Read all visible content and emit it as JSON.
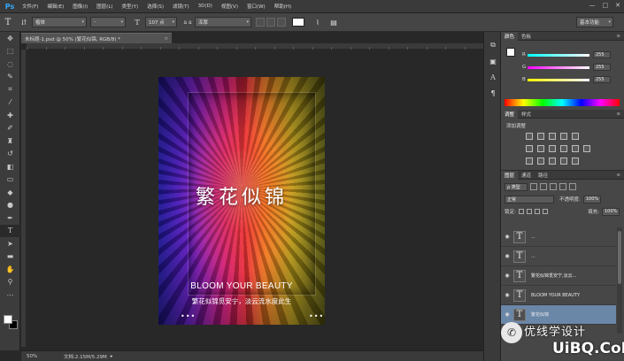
{
  "app": {
    "logo": "Ps"
  },
  "menu": [
    "文件(F)",
    "编辑(E)",
    "图像(I)",
    "图层(L)",
    "类型(Y)",
    "选择(S)",
    "滤镜(T)",
    "3D(D)",
    "视图(V)",
    "窗口(W)",
    "帮助(H)"
  ],
  "window_controls": [
    "—",
    "□",
    "✕"
  ],
  "options": {
    "font_family": "楷体",
    "font_style": "-",
    "font_size": "107 点",
    "aa_label": "a a",
    "aa_value": "浑厚",
    "text_color": "#ffffff",
    "workspace": "基本功能"
  },
  "document": {
    "tab_title": "未标题-1.psd @ 50% (繁花似锦, RGB/8) *",
    "tab_close": "×",
    "zoom": "50%",
    "doc_size": "文档:2.15M/5.29M"
  },
  "artwork": {
    "title": "繁花似锦",
    "subtitle": "BLOOM YOUR BEAUTY",
    "tagline": "繁花似锦觅安宁，淡云流水度此生",
    "dots_left": "•••",
    "dots_right": "•••"
  },
  "color_panel": {
    "tabs": [
      "颜色",
      "色板"
    ],
    "r_label": "R",
    "r_value": "255",
    "g_label": "G",
    "g_value": "255",
    "b_label": "B",
    "b_value": "255"
  },
  "adjust_panel": {
    "tabs": [
      "调整",
      "样式"
    ],
    "label": "添加调整"
  },
  "layers_panel": {
    "tabs": [
      "图层",
      "通道",
      "路径"
    ],
    "filter": "ρ 类型",
    "blend_mode": "正常",
    "opacity_label": "不透明度:",
    "opacity_value": "100%",
    "lock_label": "锁定:",
    "fill_label": "填充:",
    "fill_value": "100%",
    "layers": [
      {
        "name": "...",
        "selected": false
      },
      {
        "name": "...",
        "selected": false
      },
      {
        "name": "繁花似锦觅安宁,淡云...",
        "selected": false
      },
      {
        "name": "BLOOM YOUR BEAUTY",
        "selected": false
      },
      {
        "name": "繁花似锦",
        "selected": true
      }
    ]
  },
  "watermark": {
    "cn": "优线学设计",
    "en": "UiBQ.CoM"
  },
  "colors": {
    "accent": "#31a8ff",
    "selected_layer": "#6b87a8"
  }
}
